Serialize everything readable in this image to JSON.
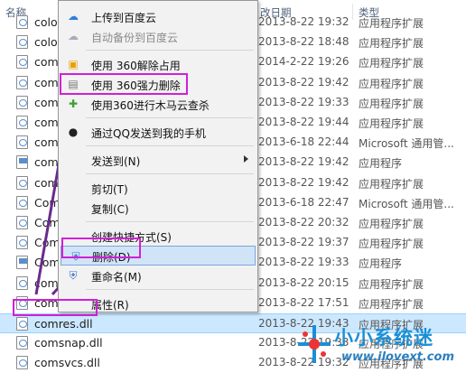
{
  "header": {
    "name": "名称",
    "date": "改日期",
    "type": "类型"
  },
  "files": [
    {
      "name": "colo",
      "date": "2013-8-22 19:32",
      "type": "应用程序扩展",
      "icon": "dll-file-icon"
    },
    {
      "name": "colo",
      "date": "2013-8-22 18:48",
      "type": "应用程序扩展",
      "icon": "dll-file-icon"
    },
    {
      "name": "com",
      "date": "2014-2-22 19:26",
      "type": "应用程序扩展",
      "icon": "dll-file-icon"
    },
    {
      "name": "com",
      "date": "2013-8-22 19:42",
      "type": "应用程序扩展",
      "icon": "dll-file-icon"
    },
    {
      "name": "com",
      "date": "2013-8-22 19:33",
      "type": "应用程序扩展",
      "icon": "dll-file-icon"
    },
    {
      "name": "com",
      "date": "2013-8-22 19:44",
      "type": "应用程序扩展",
      "icon": "dll-file-icon"
    },
    {
      "name": "com",
      "date": "2013-6-18 22:44",
      "type": "Microsoft 通用管...",
      "icon": "msc-file-icon"
    },
    {
      "name": "com",
      "date": "2013-8-22 19:42",
      "type": "应用程序",
      "icon": "app-file-icon"
    },
    {
      "name": "com",
      "date": "2013-8-22 19:42",
      "type": "应用程序扩展",
      "icon": "dll-file-icon"
    },
    {
      "name": "Com",
      "date": "2013-6-18 22:47",
      "type": "Microsoft 通用管...",
      "icon": "msc-file-icon"
    },
    {
      "name": "Com",
      "date": "2013-8-22 20:32",
      "type": "应用程序扩展",
      "icon": "dll-file-icon"
    },
    {
      "name": "Com",
      "date": "2013-8-22 19:37",
      "type": "应用程序扩展",
      "icon": "dll-file-icon"
    },
    {
      "name": "Com",
      "date": "2013-8-22 19:33",
      "type": "应用程序",
      "icon": "app-file-icon"
    },
    {
      "name": "com",
      "date": "2013-8-22 20:15",
      "type": "应用程序扩展",
      "icon": "dll-file-icon"
    },
    {
      "name": "com",
      "date": "2013-8-22 17:51",
      "type": "应用程序扩展",
      "icon": "dll-file-icon"
    },
    {
      "name": "comres.dll",
      "date": "2013-8-22 19:43",
      "type": "应用程序扩展",
      "icon": "dll-file-icon",
      "selected": true
    },
    {
      "name": "comsnap.dll",
      "date": "2013-8-22 19:33",
      "type": "应用程序扩展",
      "icon": "dll-file-icon"
    },
    {
      "name": "comsvcs.dll",
      "date": "2013-8-22 19:32",
      "type": "应用程序扩展",
      "icon": "dll-file-icon"
    }
  ],
  "menu": {
    "items": [
      {
        "label": "上传到百度云",
        "icon": "baidu-cloud-icon",
        "disabled": false
      },
      {
        "label": "自动备份到百度云",
        "icon": "baidu-backup-icon",
        "disabled": true
      },
      {
        "sep": true
      },
      {
        "label": "使用 360解除占用",
        "icon": "360-unlock-icon"
      },
      {
        "label": "使用 360强力删除",
        "icon": "360-shredder-icon"
      },
      {
        "label": "使用360进行木马云查杀",
        "icon": "360-scan-icon"
      },
      {
        "sep": true
      },
      {
        "label": "通过QQ发送到我的手机",
        "icon": "qq-icon"
      },
      {
        "sep": true
      },
      {
        "label": "发送到(N)",
        "submenu": true
      },
      {
        "sep": true
      },
      {
        "label": "剪切(T)"
      },
      {
        "label": "复制(C)"
      },
      {
        "sep": true
      },
      {
        "label": "创建快捷方式(S)"
      },
      {
        "label": "删除(D)",
        "icon": "shield-icon",
        "hover": true
      },
      {
        "label": "重命名(M)",
        "icon": "shield-icon"
      },
      {
        "sep": true
      },
      {
        "label": "属性(R)"
      }
    ]
  },
  "watermark": {
    "title": "小小系统迷",
    "url": "www.ilovext.com"
  },
  "colors": {
    "highlight": "#d21fd8",
    "arrow": "#6a2a8c",
    "selection": "#cce8ff",
    "menu_hover": "#d1e4f7"
  }
}
